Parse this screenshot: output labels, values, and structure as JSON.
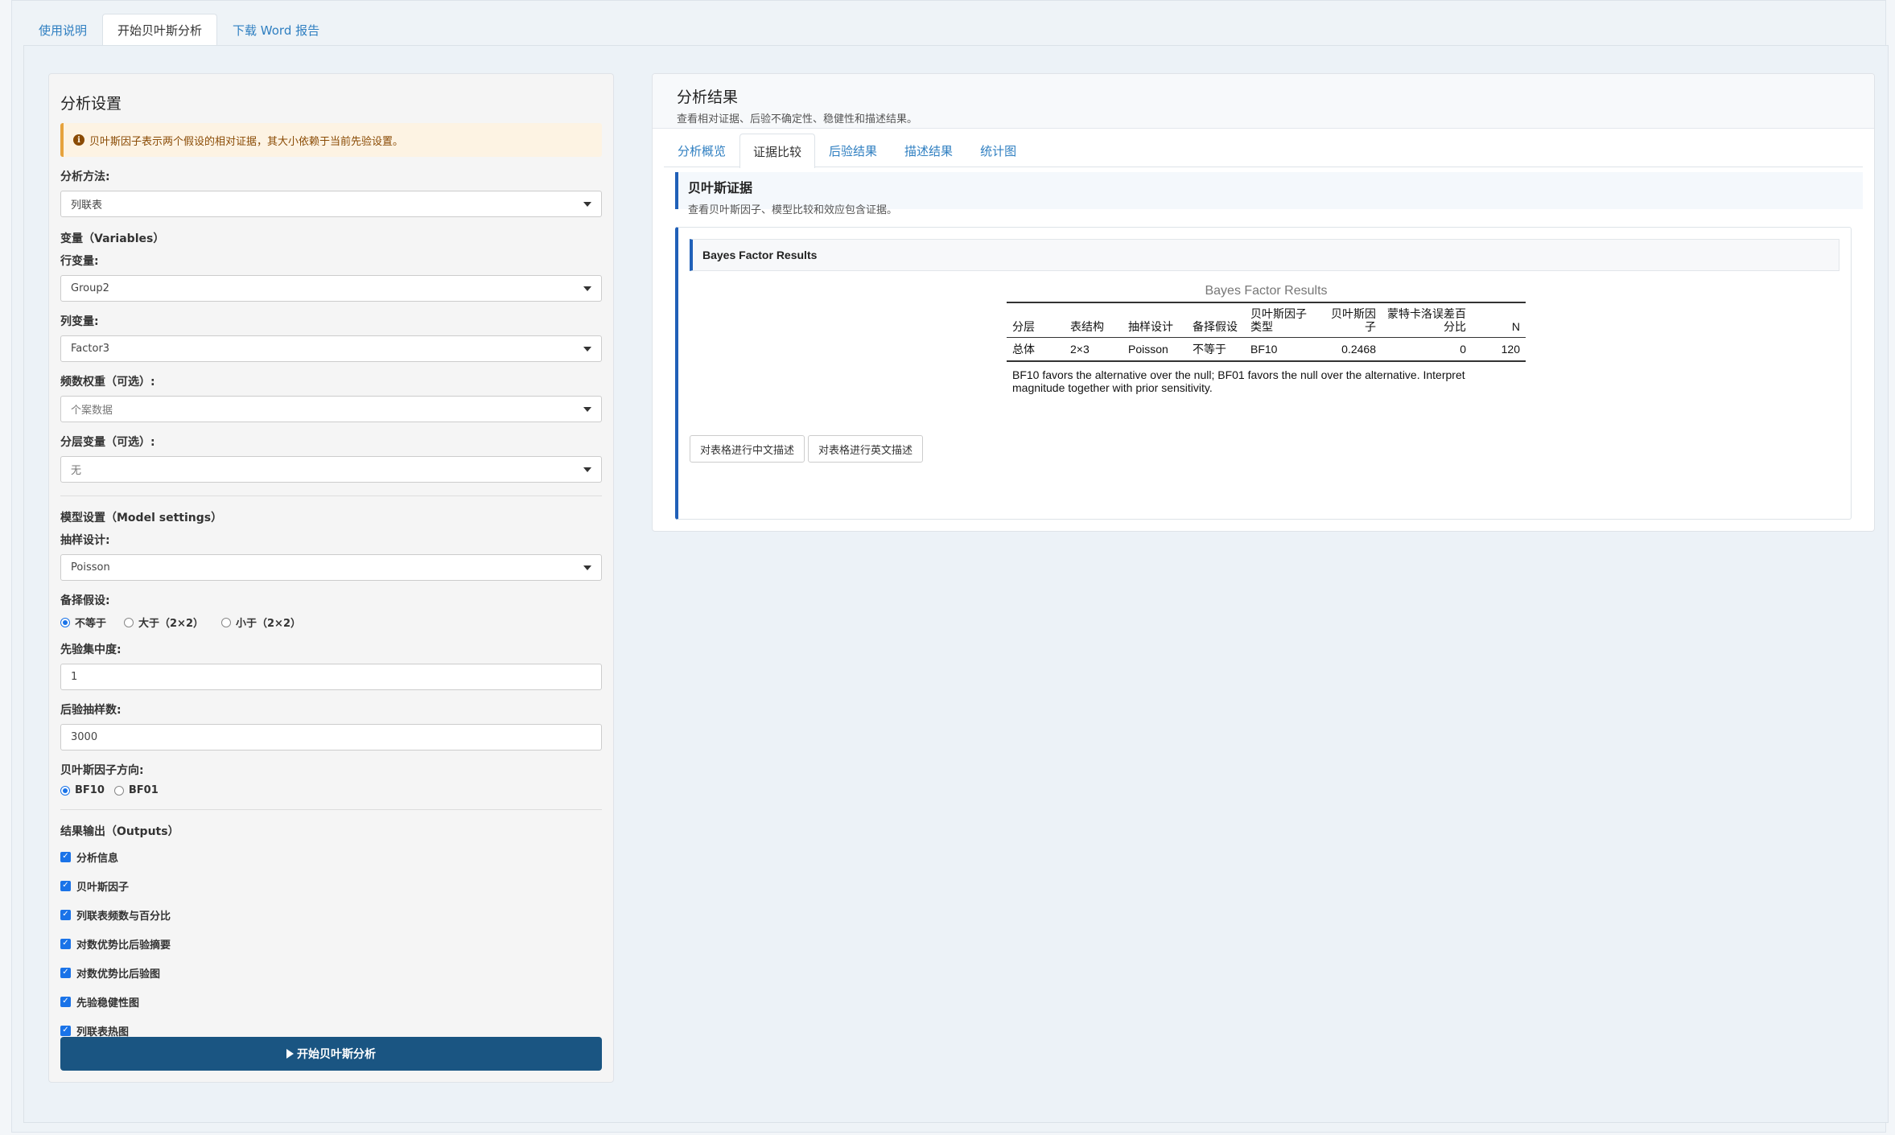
{
  "top_tabs": [
    "使用说明",
    "开始贝叶斯分析",
    "下载 Word 报告"
  ],
  "settings": {
    "title": "分析设置",
    "alert": "贝叶斯因子表示两个假设的相对证据，其大小依赖于当前先验设置。",
    "method_label": "分析方法:",
    "method_value": "列联表",
    "variables_section": "变量（Variables）",
    "row_var_label": "行变量:",
    "row_var_value": "Group2",
    "col_var_label": "列变量:",
    "col_var_value": "Factor3",
    "weight_label": "频数权重（可选）:",
    "weight_value": "个案数据",
    "strata_label": "分层变量（可选）:",
    "strata_value": "无",
    "model_section": "模型设置（Model settings）",
    "sampling_label": "抽样设计:",
    "sampling_value": "Poisson",
    "alt_label": "备择假设:",
    "alt_options": [
      "不等于",
      "大于（2×2）",
      "小于（2×2）"
    ],
    "alt_selected": "不等于",
    "prior_label": "先验集中度:",
    "prior_value": "1",
    "samples_label": "后验抽样数:",
    "samples_value": "3000",
    "bf_dir_label": "贝叶斯因子方向:",
    "bf_dir_options": [
      "BF10",
      "BF01"
    ],
    "bf_dir_selected": "BF10",
    "outputs_section": "结果输出（Outputs）",
    "outputs": [
      "分析信息",
      "贝叶斯因子",
      "列联表频数与百分比",
      "对数优势比后验摘要",
      "对数优势比后验图",
      "先验稳健性图",
      "列联表热图"
    ],
    "run_button": "开始贝叶斯分析"
  },
  "results": {
    "title": "分析结果",
    "subtitle": "查看相对证据、后验不确定性、稳健性和描述结果。",
    "tabs": [
      "分析概览",
      "证据比较",
      "后验结果",
      "描述结果",
      "统计图"
    ],
    "active_tab": "证据比较",
    "evidence_title": "贝叶斯证据",
    "evidence_subtitle": "查看贝叶斯因子、模型比较和效应包含证据。",
    "card_title": "Bayes Factor Results",
    "table": {
      "caption": "Bayes Factor Results",
      "headers": [
        "分层",
        "表结构",
        "抽样设计",
        "备择假设",
        "贝叶斯因子类型",
        "贝叶斯因子",
        "蒙特卡洛误差百分比",
        "N"
      ],
      "rows": [
        [
          "总体",
          "2×3",
          "Poisson",
          "不等于",
          "BF10",
          "0.2468",
          "0",
          "120"
        ]
      ],
      "note": "BF10 favors the alternative over the null; BF01 favors the null over the alternative. Interpret magnitude together with prior sensitivity."
    },
    "btn_cn": "对表格进行中文描述",
    "btn_en": "对表格进行英文描述"
  }
}
